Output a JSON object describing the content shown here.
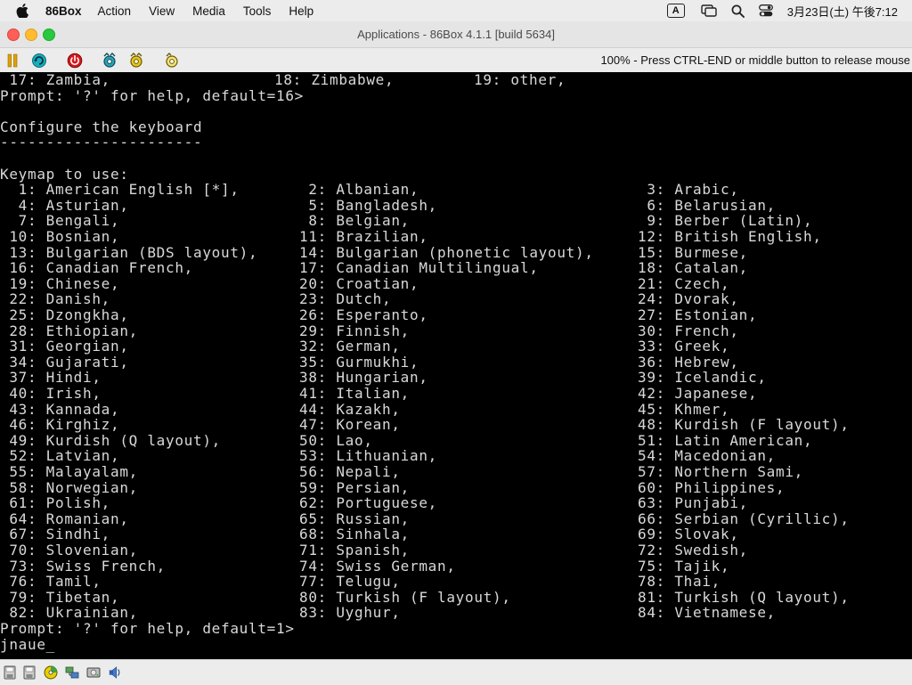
{
  "menubar": {
    "app_name": "86Box",
    "items": [
      "Action",
      "View",
      "Media",
      "Tools",
      "Help"
    ],
    "input_source": "A",
    "clock": "3月23日(土) 午後7:12"
  },
  "window": {
    "title": "Applications - 86Box 4.1.1 [build 5634]"
  },
  "toolbar": {
    "status_message": "100% - Press CTRL-END or middle button to release mouse"
  },
  "console": {
    "header_line_1": {
      "c1": " 17: Zambia,",
      "c2": "18: Zimbabwe,",
      "c3": "19: other,"
    },
    "prompt_1": "Prompt: '?' for help, default=16>",
    "section_title": "Configure the keyboard",
    "section_rule": "----------------------",
    "keymap_label": "Keymap to use:",
    "keymaps": [
      [
        "  1: American English [*],",
        " 2: Albanian,",
        " 3: Arabic,"
      ],
      [
        "  4: Asturian,",
        " 5: Bangladesh,",
        " 6: Belarusian,"
      ],
      [
        "  7: Bengali,",
        " 8: Belgian,",
        " 9: Berber (Latin),"
      ],
      [
        " 10: Bosnian,",
        "11: Brazilian,",
        "12: British English,"
      ],
      [
        " 13: Bulgarian (BDS layout),",
        "14: Bulgarian (phonetic layout),",
        "15: Burmese,"
      ],
      [
        " 16: Canadian French,",
        "17: Canadian Multilingual,",
        "18: Catalan,"
      ],
      [
        " 19: Chinese,",
        "20: Croatian,",
        "21: Czech,"
      ],
      [
        " 22: Danish,",
        "23: Dutch,",
        "24: Dvorak,"
      ],
      [
        " 25: Dzongkha,",
        "26: Esperanto,",
        "27: Estonian,"
      ],
      [
        " 28: Ethiopian,",
        "29: Finnish,",
        "30: French,"
      ],
      [
        " 31: Georgian,",
        "32: German,",
        "33: Greek,"
      ],
      [
        " 34: Gujarati,",
        "35: Gurmukhi,",
        "36: Hebrew,"
      ],
      [
        " 37: Hindi,",
        "38: Hungarian,",
        "39: Icelandic,"
      ],
      [
        " 40: Irish,",
        "41: Italian,",
        "42: Japanese,"
      ],
      [
        " 43: Kannada,",
        "44: Kazakh,",
        "45: Khmer,"
      ],
      [
        " 46: Kirghiz,",
        "47: Korean,",
        "48: Kurdish (F layout),"
      ],
      [
        " 49: Kurdish (Q layout),",
        "50: Lao,",
        "51: Latin American,"
      ],
      [
        " 52: Latvian,",
        "53: Lithuanian,",
        "54: Macedonian,"
      ],
      [
        " 55: Malayalam,",
        "56: Nepali,",
        "57: Northern Sami,"
      ],
      [
        " 58: Norwegian,",
        "59: Persian,",
        "60: Philippines,"
      ],
      [
        " 61: Polish,",
        "62: Portuguese,",
        "63: Punjabi,"
      ],
      [
        " 64: Romanian,",
        "65: Russian,",
        "66: Serbian (Cyrillic),"
      ],
      [
        " 67: Sindhi,",
        "68: Sinhala,",
        "69: Slovak,"
      ],
      [
        " 70: Slovenian,",
        "71: Spanish,",
        "72: Swedish,"
      ],
      [
        " 73: Swiss French,",
        "74: Swiss German,",
        "75: Tajik,"
      ],
      [
        " 76: Tamil,",
        "77: Telugu,",
        "78: Thai,"
      ],
      [
        " 79: Tibetan,",
        "80: Turkish (F layout),",
        "81: Turkish (Q layout),"
      ],
      [
        " 82: Ukrainian,",
        "83: Uyghur,",
        "84: Vietnamese,"
      ]
    ],
    "prompt_2": "Prompt: '?' for help, default=1>",
    "input_value": "jnaue_"
  },
  "icons": {
    "toolbar": [
      "pause-icon",
      "ctrl-alt-del-icon",
      "power-icon",
      "settings-icon",
      "hard-reset-icon",
      "mouse-capture-icon"
    ],
    "statusbar": [
      "floppy-drive-1-icon",
      "floppy-drive-2-icon",
      "cdrom-icon",
      "network-icon",
      "hard-disk-icon",
      "sound-icon"
    ]
  },
  "colors": {
    "console_bg": "#000000",
    "console_text": "#d9d9d9",
    "chrome_bg": "#ececec"
  }
}
